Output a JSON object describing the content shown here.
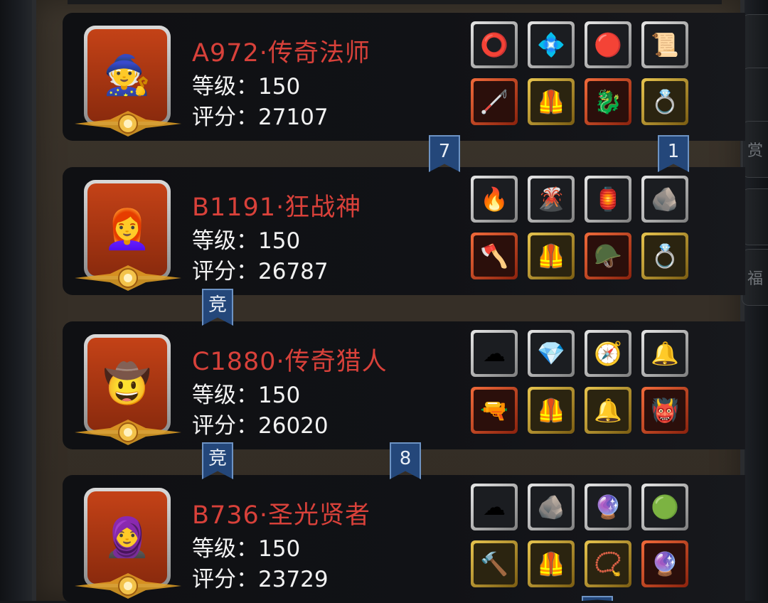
{
  "side_tabs": [
    "",
    "",
    "赏",
    "",
    "福"
  ],
  "rows": [
    {
      "name": "A972·传奇法师",
      "level": "等级：150",
      "score": "评分：27107",
      "portrait_icon": "wizard-elder",
      "portrait_glyph": "🧙",
      "slots": [
        {
          "icon": "bracer-icon",
          "glyph": "⭕",
          "frame": "gray"
        },
        {
          "icon": "blue-gem-icon",
          "glyph": "💠",
          "frame": "gray"
        },
        {
          "icon": "red-gem-icon",
          "glyph": "🔴",
          "frame": "gray"
        },
        {
          "icon": "scroll-icon",
          "glyph": "📜",
          "frame": "gray"
        },
        {
          "icon": "staff-icon",
          "glyph": "🦯",
          "frame": "red"
        },
        {
          "icon": "armor-icon",
          "glyph": "🦺",
          "frame": "gold"
        },
        {
          "icon": "dragon-helm-icon",
          "glyph": "🐉",
          "frame": "red"
        },
        {
          "icon": "ring-icon",
          "glyph": "💍",
          "frame": "gold"
        }
      ]
    },
    {
      "name": "B1191·狂战神",
      "level": "等级：150",
      "score": "评分：26787",
      "portrait_icon": "berserker-woman",
      "portrait_glyph": "👩‍🦰",
      "slots": [
        {
          "icon": "flame-crown-icon",
          "glyph": "🔥",
          "frame": "gray"
        },
        {
          "icon": "fire-orb-icon",
          "glyph": "🌋",
          "frame": "gray"
        },
        {
          "icon": "lantern-icon",
          "glyph": "🏮",
          "frame": "gray"
        },
        {
          "icon": "stone-icon",
          "glyph": "🪨",
          "frame": "gray"
        },
        {
          "icon": "axe-icon",
          "glyph": "🪓",
          "frame": "red"
        },
        {
          "icon": "armor-icon",
          "glyph": "🦺",
          "frame": "gold"
        },
        {
          "icon": "helm-icon",
          "glyph": "🪖",
          "frame": "red"
        },
        {
          "icon": "ring-icon",
          "glyph": "💍",
          "frame": "gold"
        }
      ]
    },
    {
      "name": "C1880·传奇猎人",
      "level": "等级：150",
      "score": "评分：26020",
      "portrait_icon": "hunter-hat",
      "portrait_glyph": "🤠",
      "slots": [
        {
          "icon": "cloud-ring-icon",
          "glyph": "☁",
          "frame": "gray"
        },
        {
          "icon": "teal-gem-icon",
          "glyph": "💎",
          "frame": "gray"
        },
        {
          "icon": "compass-icon",
          "glyph": "🧭",
          "frame": "gray"
        },
        {
          "icon": "bell-icon",
          "glyph": "🔔",
          "frame": "gray"
        },
        {
          "icon": "pistol-icon",
          "glyph": "🔫",
          "frame": "red"
        },
        {
          "icon": "armor-icon",
          "glyph": "🦺",
          "frame": "gold"
        },
        {
          "icon": "bell-icon",
          "glyph": "🔔",
          "frame": "gold"
        },
        {
          "icon": "demon-mask-icon",
          "glyph": "👹",
          "frame": "red"
        }
      ]
    },
    {
      "name": "B736·圣光贤者",
      "level": "等级：150",
      "score": "评分：23729",
      "portrait_icon": "sage-hood",
      "portrait_glyph": "🧕",
      "slots": [
        {
          "icon": "cloud-ring-icon",
          "glyph": "☁",
          "frame": "gray"
        },
        {
          "icon": "ore-icon",
          "glyph": "🪨",
          "frame": "gray"
        },
        {
          "icon": "purple-crystal-icon",
          "glyph": "🔮",
          "frame": "gray"
        },
        {
          "icon": "teal-stone-icon",
          "glyph": "🟢",
          "frame": "gray"
        },
        {
          "icon": "club-icon",
          "glyph": "🔨",
          "frame": "gold"
        },
        {
          "icon": "armor-icon",
          "glyph": "🦺",
          "frame": "gold"
        },
        {
          "icon": "amulet-icon",
          "glyph": "📿",
          "frame": "gold"
        },
        {
          "icon": "orb-icon",
          "glyph": "🔮",
          "frame": "red"
        }
      ]
    }
  ],
  "banners": [
    {
      "text": "7"
    },
    {
      "text": "1"
    },
    {
      "text": "竞"
    },
    {
      "text": "竞"
    },
    {
      "text": "8"
    },
    {
      "text": ""
    }
  ],
  "colors": {
    "name": "#d8413a",
    "stat": "#f2f2f2",
    "banner": "#24477a",
    "panel": "#382f27"
  }
}
